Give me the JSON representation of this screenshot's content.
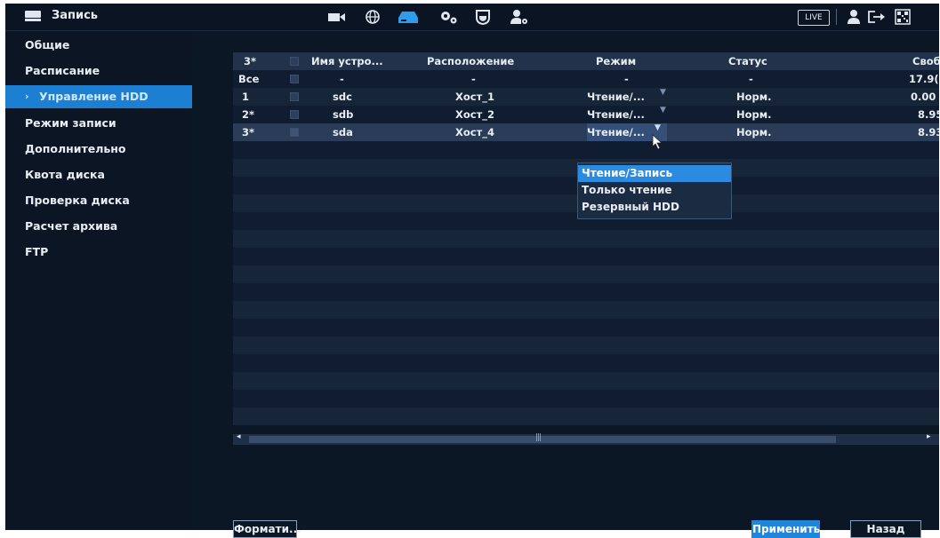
{
  "header": {
    "title": "Запись",
    "live_label": "LIVE",
    "icons": [
      "camera-icon",
      "network-icon",
      "storage-icon",
      "settings-icon",
      "shield-icon",
      "user-settings-icon",
      "user-icon",
      "logout-icon",
      "qr-icon"
    ]
  },
  "sidebar": {
    "items": [
      {
        "label": "Общие"
      },
      {
        "label": "Расписание"
      },
      {
        "label": "Управление HDD"
      },
      {
        "label": "Режим записи"
      },
      {
        "label": "Дополнительно"
      },
      {
        "label": "Квота диска"
      },
      {
        "label": "Проверка диска"
      },
      {
        "label": "Расчет архива"
      },
      {
        "label": "FTP"
      }
    ]
  },
  "table": {
    "columns": [
      "3*",
      "Имя устро...",
      "Расположение",
      "Режим",
      "Статус",
      "Своб"
    ],
    "rows": [
      {
        "num": "Все",
        "name": "-",
        "location": "-",
        "mode": "-",
        "status": "-",
        "free": "17.9("
      },
      {
        "num": "1",
        "name": "sdc",
        "location": "Хост_1",
        "mode": "Чтение/...",
        "status": "Норм.",
        "free": "0.00"
      },
      {
        "num": "2*",
        "name": "sdb",
        "location": "Хост_2",
        "mode": "Чтение/...",
        "status": "Норм.",
        "free": "8.95"
      },
      {
        "num": "3*",
        "name": "sda",
        "location": "Хост_4",
        "mode": "Чтение/...",
        "status": "Норм.",
        "free": "8.93"
      }
    ]
  },
  "dropdown": {
    "options": [
      "Чтение/Запись",
      "Только чтение",
      "Резервный HDD"
    ]
  },
  "buttons": {
    "format": "Формати...",
    "apply": "Применить",
    "back": "Назад"
  },
  "colors": {
    "accent": "#1f86dc",
    "background": "#0c1726"
  }
}
